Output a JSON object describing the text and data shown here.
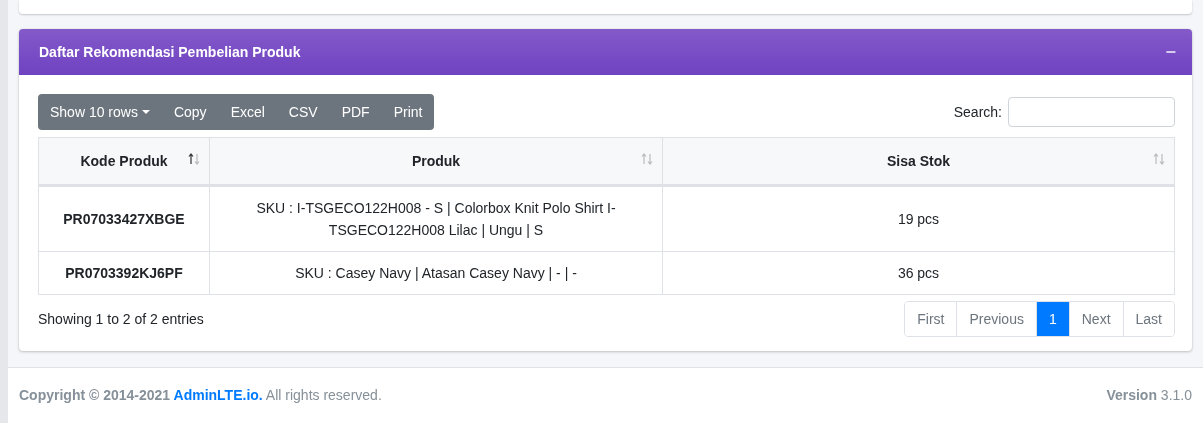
{
  "card": {
    "title": "Daftar Rekomendasi Pembelian Produk",
    "collapse_icon": "−"
  },
  "toolbar": {
    "buttons": [
      {
        "label": "Show 10 rows",
        "kind": "dropdown"
      },
      {
        "label": "Copy",
        "kind": "plain"
      },
      {
        "label": "Excel",
        "kind": "plain"
      },
      {
        "label": "CSV",
        "kind": "plain"
      },
      {
        "label": "PDF",
        "kind": "plain"
      },
      {
        "label": "Print",
        "kind": "plain"
      }
    ]
  },
  "search": {
    "label": "Search:"
  },
  "table": {
    "columns": [
      {
        "label": "Kode Produk",
        "sorted": true
      },
      {
        "label": "Produk",
        "sorted": false
      },
      {
        "label": "Sisa Stok",
        "sorted": false
      }
    ],
    "rows": [
      [
        "PR07033427XBGE",
        "SKU : I-TSGECO122H008 - S | Colorbox Knit Polo Shirt I-TSGECO122H008 Lilac | Ungu | S",
        "19 pcs"
      ],
      [
        "PR0703392KJ6PF",
        "SKU : Casey Navy | Atasan Casey Navy | - | -",
        "36 pcs"
      ]
    ]
  },
  "info": "Showing 1 to 2 of 2 entries",
  "pagination": [
    {
      "label": "First",
      "selected": false
    },
    {
      "label": "Previous",
      "selected": false
    },
    {
      "label": "1",
      "selected": true
    },
    {
      "label": "Next",
      "selected": false
    },
    {
      "label": "Last",
      "selected": false
    }
  ],
  "footer": {
    "copyright": "Copyright © 2014-2021 ",
    "link": "AdminLTE.io.",
    "rights": " All rights reserved.",
    "version_label": "Version",
    "version": "3.1.0"
  }
}
